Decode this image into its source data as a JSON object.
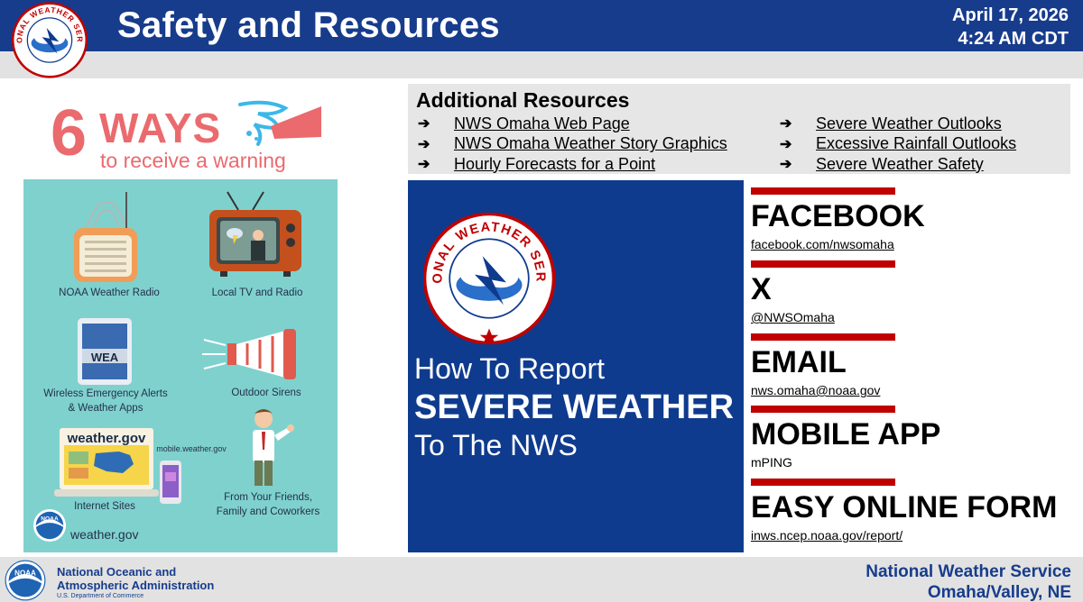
{
  "header": {
    "title": "Safety and Resources",
    "date": "April 17, 2026",
    "time": "4:24 AM CDT",
    "logo_icon": "nws-logo-icon",
    "logo_text": "NATIONAL WEATHER SERVICE",
    "bg_color": "#173c8c"
  },
  "infographic": {
    "number": "6",
    "heading": "WAYS",
    "subheading": "to receive a warning",
    "items": [
      {
        "label": "NOAA Weather Radio",
        "icon": "radio-icon"
      },
      {
        "label": "Local TV and Radio",
        "icon": "tv-icon"
      },
      {
        "label": "Wireless Emergency Alerts\n& Weather Apps",
        "icon": "tablet-icon"
      },
      {
        "label": "Outdoor Sirens",
        "icon": "siren-icon"
      },
      {
        "label": "Internet Sites",
        "icon": "laptop-icon"
      },
      {
        "label": "From Your Friends,\nFamily and Coworkers",
        "icon": "person-icon"
      }
    ],
    "wea_label": "WEA",
    "screen_site": "weather.gov",
    "mobile_site": "mobile.weather.gov",
    "footer_site": "weather.gov",
    "panel_color": "#7fd1ce",
    "accent_color": "#ea6a6e"
  },
  "resources": {
    "title": "Additional Resources",
    "left_links": [
      "NWS Omaha Web Page",
      "NWS Omaha Weather Story Graphics",
      "Hourly Forecasts for a Point"
    ],
    "right_links": [
      "Severe Weather Outlooks",
      "Excessive Rainfall Outlooks",
      "Severe Weather Safety"
    ],
    "arrow": "➔"
  },
  "report": {
    "line1": "How To Report",
    "line2": "SEVERE WEATHER",
    "line3": "To The NWS",
    "logo_text": "NATIONAL WEATHER SERVICE",
    "bg_color": "#0f3b8e"
  },
  "contacts": [
    {
      "label": "FACEBOOK",
      "value": "facebook.com/nwsomaha"
    },
    {
      "label": "X",
      "value": "@NWSOmaha"
    },
    {
      "label": "EMAIL",
      "value": "nws.omaha@noaa.gov"
    },
    {
      "label": "MOBILE APP",
      "value": "mPING"
    },
    {
      "label": "EASY ONLINE FORM",
      "value": "inws.ncep.noaa.gov/report/"
    }
  ],
  "footer": {
    "noaa_logo_text": "NOAA",
    "noaa_name_line1": "National Oceanic and",
    "noaa_name_line2": "Atmospheric Administration",
    "noaa_dept": "U.S. Department of Commerce",
    "nws_name": "National Weather Service",
    "nws_office": "Omaha/Valley, NE"
  }
}
